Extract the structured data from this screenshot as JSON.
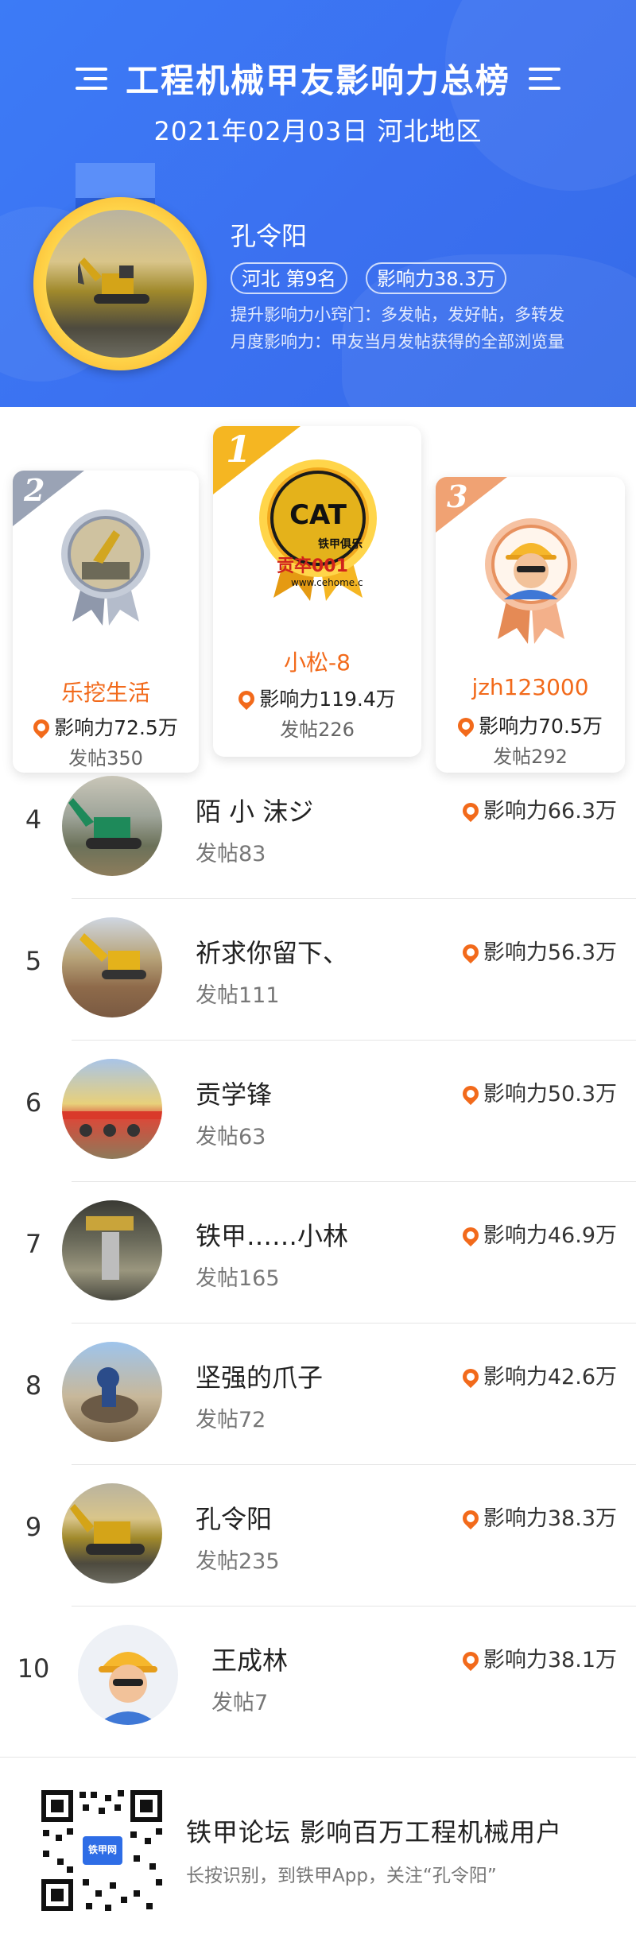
{
  "header": {
    "title": "工程机械甲友影响力总榜",
    "date_region": "2021年02月03日 河北地区",
    "user": {
      "name": "孔令阳",
      "region_rank": "河北  第9名",
      "influence": "影响力38.3万",
      "tip1": "提升影响力小窍门：多发帖，发好帖，多转发",
      "tip2": "月度影响力：甲友当月发帖获得的全部浏览量"
    }
  },
  "podium": [
    {
      "rank": "2",
      "name": "乐挖生活",
      "influence": "影响力72.5万",
      "posts": "发帖350",
      "name_color": "#f26a1b"
    },
    {
      "rank": "1",
      "name": "小松-8",
      "influence": "影响力119.4万",
      "posts": "发帖226",
      "name_color": "#f26a1b",
      "logo_text": "CAT",
      "logo_sub": "铁甲俱乐",
      "logo_red": "贡卒001",
      "logo_url": "www.cehome.c"
    },
    {
      "rank": "3",
      "name": "jzh123000",
      "influence": "影响力70.5万",
      "posts": "发帖292",
      "name_color": "#f26a1b"
    }
  ],
  "list": [
    {
      "rank": "4",
      "name": "陌 小 沫ジ",
      "posts": "发帖83",
      "influence": "影响力66.3万"
    },
    {
      "rank": "5",
      "name": "祈求你留下、",
      "posts": "发帖111",
      "influence": "影响力56.3万"
    },
    {
      "rank": "6",
      "name": "贡学锋",
      "posts": "发帖63",
      "influence": "影响力50.3万"
    },
    {
      "rank": "7",
      "name": "铁甲……小林",
      "posts": "发帖165",
      "influence": "影响力46.9万"
    },
    {
      "rank": "8",
      "name": "坚强的爪子",
      "posts": "发帖72",
      "influence": "影响力42.6万"
    },
    {
      "rank": "9",
      "name": "孔令阳",
      "posts": "发帖235",
      "influence": "影响力38.3万"
    },
    {
      "rank": "10",
      "name": "王成林",
      "posts": "发帖7",
      "influence": "影响力38.1万"
    }
  ],
  "footer": {
    "title": "铁甲论坛 影响百万工程机械用户",
    "subtitle": "长按识别，到铁甲App，关注“孔令阳”",
    "qr_label": "铁甲网"
  },
  "colors": {
    "header_blue": "#3b72f2",
    "accent_orange": "#f26a1b",
    "gold": "#f5b622",
    "silver": "#9aa3b5",
    "bronze": "#f0a273"
  }
}
